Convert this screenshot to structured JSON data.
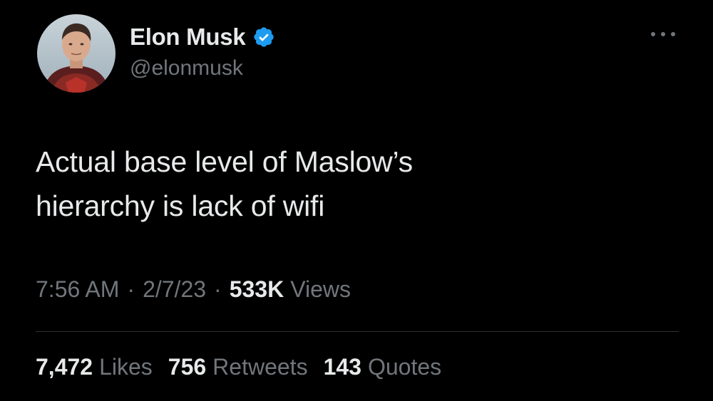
{
  "author": {
    "name": "Elon Musk",
    "handle": "@elonmusk",
    "verified": true
  },
  "tweet": {
    "text_line1": "Actual base level of Maslow’s",
    "text_line2": "hierarchy is lack of wifi"
  },
  "meta": {
    "time": "7:56 AM",
    "separator": "·",
    "date": "2/7/23",
    "views_count": "533K",
    "views_label": "Views"
  },
  "stats": {
    "likes_count": "7,472",
    "likes_label": "Likes",
    "retweets_count": "756",
    "retweets_label": "Retweets",
    "quotes_count": "143",
    "quotes_label": "Quotes"
  },
  "icons": {
    "verified": "verified-badge-icon",
    "more": "more-options-icon"
  },
  "colors": {
    "background": "#000000",
    "text_primary": "#e7e9ea",
    "text_secondary": "#71767b",
    "verified_blue": "#1d9bf0",
    "divider": "#2f3336"
  }
}
